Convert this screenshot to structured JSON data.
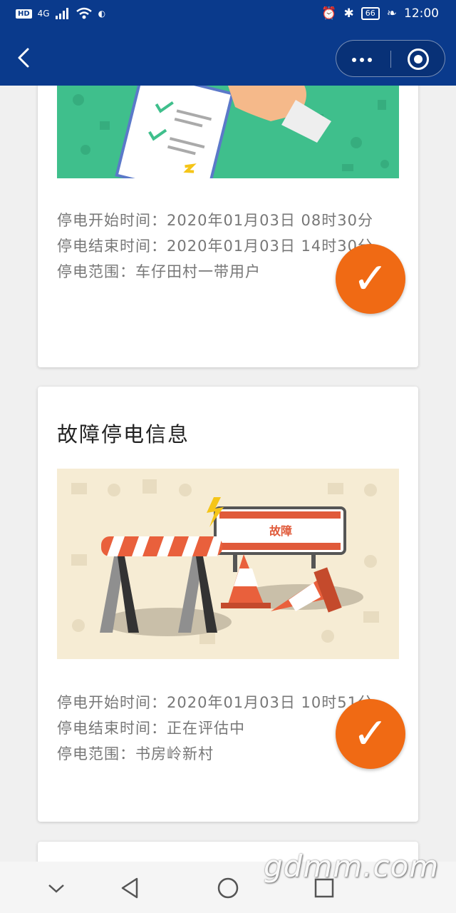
{
  "status_bar": {
    "network": "4G",
    "battery": "66",
    "time": "12:00"
  },
  "nav": {
    "icons": [
      "back-chevron-icon",
      "more-dots-icon",
      "target-close-icon"
    ]
  },
  "cards": [
    {
      "illustration": "checklist-hand-illustration",
      "start_time": "停电开始时间：2020年01月03日  08时30分",
      "end_time": "停电结束时间：2020年01月03日  14时30分",
      "scope": "停电范围：车仔田村一带用户"
    },
    {
      "title": "故障停电信息",
      "illustration": "roadblock-fault-illustration",
      "sign_text": "故障",
      "start_time": "停电开始时间：2020年01月03日  10时51分",
      "end_time": "停电结束时间：正在评估中",
      "scope": "停电范围：书房岭新村"
    }
  ],
  "check_mark": "✓",
  "watermark": "gdmm.com",
  "colors": {
    "nav_bg": "#0a3a8c",
    "accent_orange": "#f06a14",
    "illustration_green": "#3fbf8c",
    "illustration_beige": "#f6ecd4"
  }
}
